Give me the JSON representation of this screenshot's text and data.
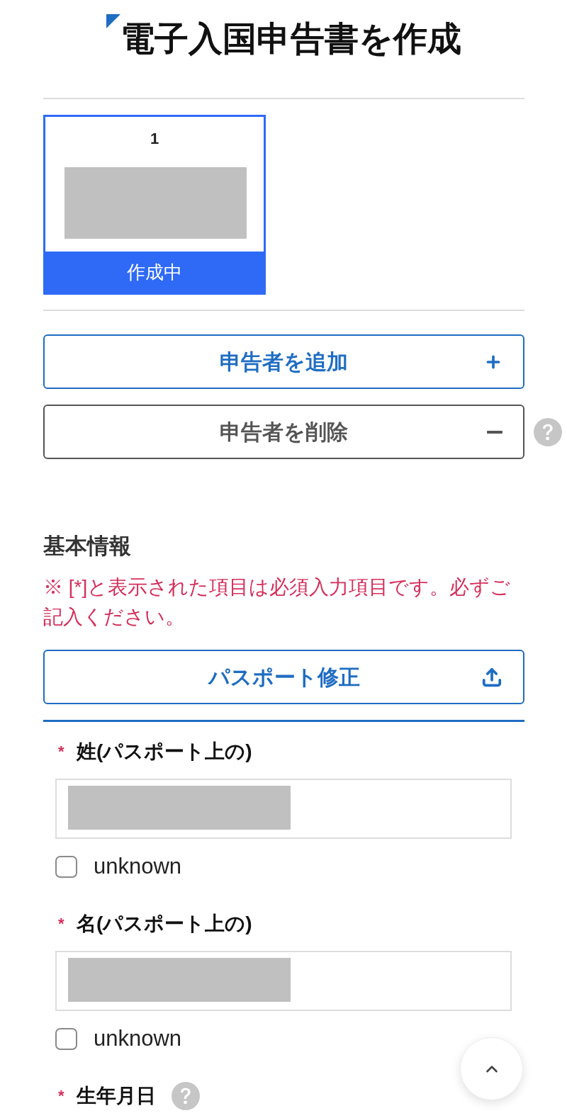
{
  "page_title": "電子入国申告書を作成",
  "declarants": [
    {
      "number": "1",
      "status": "作成中",
      "selected": true
    }
  ],
  "buttons": [
    {
      "kind": "add",
      "label": "申告者を追加"
    },
    {
      "kind": "remove",
      "label": "申告者を削除",
      "help": true
    }
  ],
  "section": {
    "title": "基本情報",
    "note": "※ [*]と表示された項目は必須入力項目です。必ずご記入ください。",
    "passport_button": {
      "kind": "upload",
      "label": "パスポート修正"
    }
  },
  "fields": [
    {
      "kind": "text",
      "required_mark": "*",
      "label": "姓(パスポート上の)",
      "unknown_option": {
        "label": "unknown",
        "checked": false
      }
    },
    {
      "kind": "text",
      "required_mark": "*",
      "label": "名(パスポート上の)",
      "unknown_option": {
        "label": "unknown",
        "checked": false
      }
    },
    {
      "kind": "date",
      "required_mark": "*",
      "label": "生年月日",
      "help": true
    }
  ]
}
